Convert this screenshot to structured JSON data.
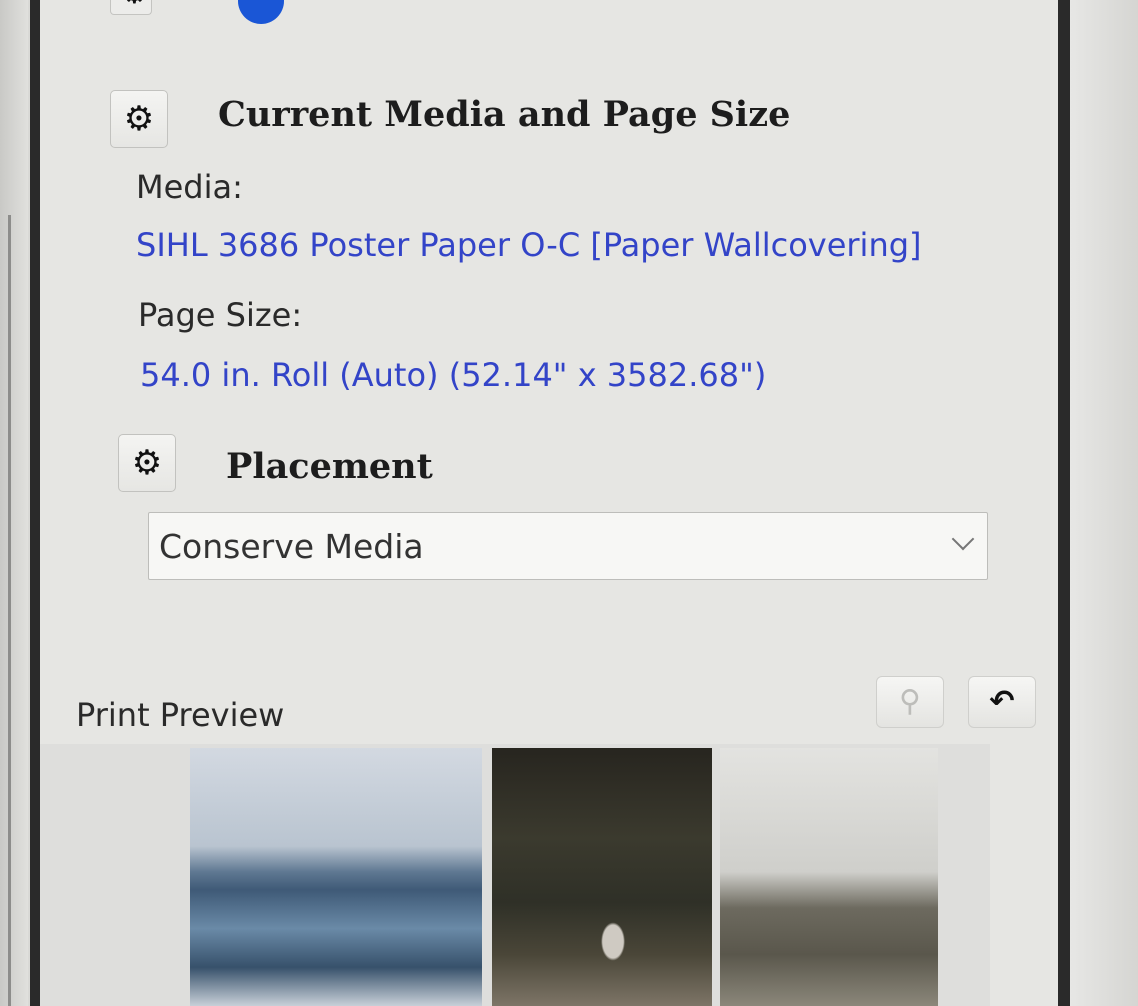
{
  "colors": {
    "link_blue": "#3344c8",
    "panel_bg": "#e6e6e3",
    "text": "#2a2a2a"
  },
  "icons": {
    "top_left": "gear-icon",
    "top_right": "info-icon",
    "settings": "gear-icon",
    "zoom": "magnifier-icon",
    "undo": "undo-icon"
  },
  "media_section": {
    "title": "Current Media and Page Size",
    "media_label": "Media:",
    "media_value": "SIHL 3686 Poster Paper O-C [Paper  Wallcovering]",
    "page_size_label": "Page Size:",
    "page_size_value": "54.0 in. Roll (Auto) (52.14\" x 3582.68\")"
  },
  "placement_section": {
    "title": "Placement",
    "selected": "Conserve Media"
  },
  "print_preview": {
    "label": "Print Preview",
    "images": [
      "lake-landscape",
      "couple-forest",
      "hills-mist"
    ]
  }
}
